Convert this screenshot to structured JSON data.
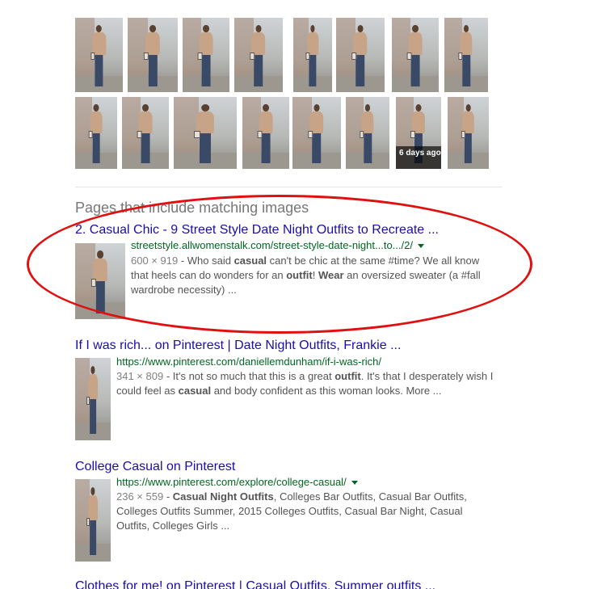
{
  "thumb_rows": [
    [
      {},
      {},
      {},
      {},
      {},
      {},
      {},
      {}
    ],
    [
      {},
      {},
      {},
      {},
      {},
      {},
      {
        "badge": "6 days ago"
      },
      {}
    ]
  ],
  "section": {
    "title": "Pages that include matching images"
  },
  "results": [
    {
      "title": "2. Casual Chic - 9 Street Style Date Night Outfits to Recreate ...",
      "url": "streetstyle.allwomenstalk.com/street-style-date-night...to.../2/",
      "dims": "600 × 919",
      "snippet_lines": [
        [
          {
            "t": " - Who said "
          },
          {
            "t": "casual",
            "b": true
          },
          {
            "t": " can't be chic at the same #time? We all know"
          }
        ],
        [
          {
            "t": "that heels can do wonders for an "
          },
          {
            "t": "outfit",
            "b": true
          },
          {
            "t": "! "
          },
          {
            "t": "Wear",
            "b": true
          },
          {
            "t": " an oversized sweater (a #fall"
          }
        ],
        [
          {
            "t": "wardrobe necessity) ..."
          }
        ]
      ]
    },
    {
      "title": "If I was rich... on Pinterest | Date Night Outfits, Frankie ...",
      "url": "https://www.pinterest.com/daniellemdunham/if-i-was-rich/",
      "dims": "341 × 809",
      "snippet_lines": [
        [
          {
            "t": " - It's not so much that this is a great "
          },
          {
            "t": "outfit",
            "b": true
          },
          {
            "t": ". It's that I desperately wish I"
          }
        ],
        [
          {
            "t": "could feel as "
          },
          {
            "t": "casual",
            "b": true
          },
          {
            "t": " and body confident as this woman looks. More ..."
          }
        ]
      ]
    },
    {
      "title": "College Casual on Pinterest",
      "url": "https://www.pinterest.com/explore/college-casual/",
      "dims": "236 × 559",
      "snippet_lines": [
        [
          {
            "t": " - "
          },
          {
            "t": "Casual Night Outfits",
            "b": true
          },
          {
            "t": ", Colleges Bar Outfits, Casual Bar Outfits,"
          }
        ],
        [
          {
            "t": "Colleges Outfits Summer, 2015 Colleges Outfits, Casual Bar Night, Casual"
          }
        ],
        [
          {
            "t": "Outfits, Colleges Girls ..."
          }
        ]
      ]
    },
    {
      "title": "Clothes for me! on Pinterest | Casual Outfits, Summer outfits ..."
    }
  ],
  "colors": {
    "link": "#1a0dab",
    "url": "#006621",
    "snippet": "#545454",
    "annotation": "#e01010"
  }
}
